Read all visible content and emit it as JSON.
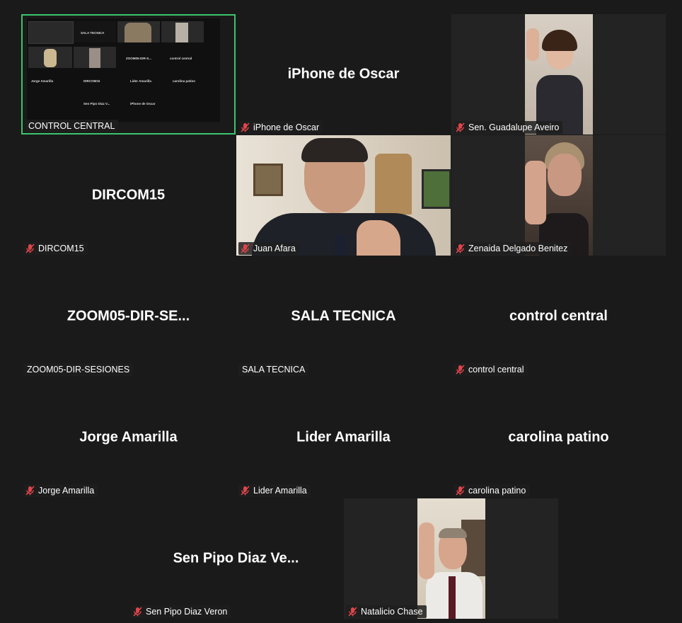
{
  "colors": {
    "background": "#1a1a1a",
    "active_border": "#3cc46e",
    "mute_icon": "#e0454b"
  },
  "tiles": [
    {
      "display_name": "",
      "label": "CONTROL CENTRAL",
      "muted": false,
      "active": true
    },
    {
      "display_name": "iPhone de Oscar",
      "label": "iPhone de Oscar",
      "muted": true
    },
    {
      "display_name": "",
      "label": "Sen. Guadalupe Aveiro",
      "muted": true
    },
    {
      "display_name": "DIRCOM15",
      "label": "DIRCOM15",
      "muted": true
    },
    {
      "display_name": "",
      "label": "Juan Afara",
      "muted": true
    },
    {
      "display_name": "",
      "label": "Zenaida Delgado Benitez",
      "muted": true
    },
    {
      "display_name": "ZOOM05-DIR-SE...",
      "label": "ZOOM05-DIR-SESIONES",
      "muted": false
    },
    {
      "display_name": "SALA TECNICA",
      "label": "SALA TECNICA",
      "muted": false
    },
    {
      "display_name": "control central",
      "label": "control central",
      "muted": true
    },
    {
      "display_name": "Jorge Amarilla",
      "label": "Jorge Amarilla",
      "muted": true
    },
    {
      "display_name": "Lider Amarilla",
      "label": "Lider Amarilla",
      "muted": true
    },
    {
      "display_name": "carolina patino",
      "label": "carolina patino",
      "muted": true
    },
    {
      "display_name": "Sen Pipo Diaz Ve...",
      "label": "Sen Pipo Diaz Veron",
      "muted": true
    },
    {
      "display_name": "",
      "label": "Natalicio Chase",
      "muted": true
    }
  ],
  "shared_screen": {
    "names": [
      "SALA TECNICA",
      "control central",
      "ZOOM05-DIR-S...",
      "Jorge Amarilla",
      "DIRCOM15",
      "Lider Amarilla",
      "carolina patino",
      "Sen Pipo Diaz V...",
      "iPhone de Oscar"
    ]
  }
}
